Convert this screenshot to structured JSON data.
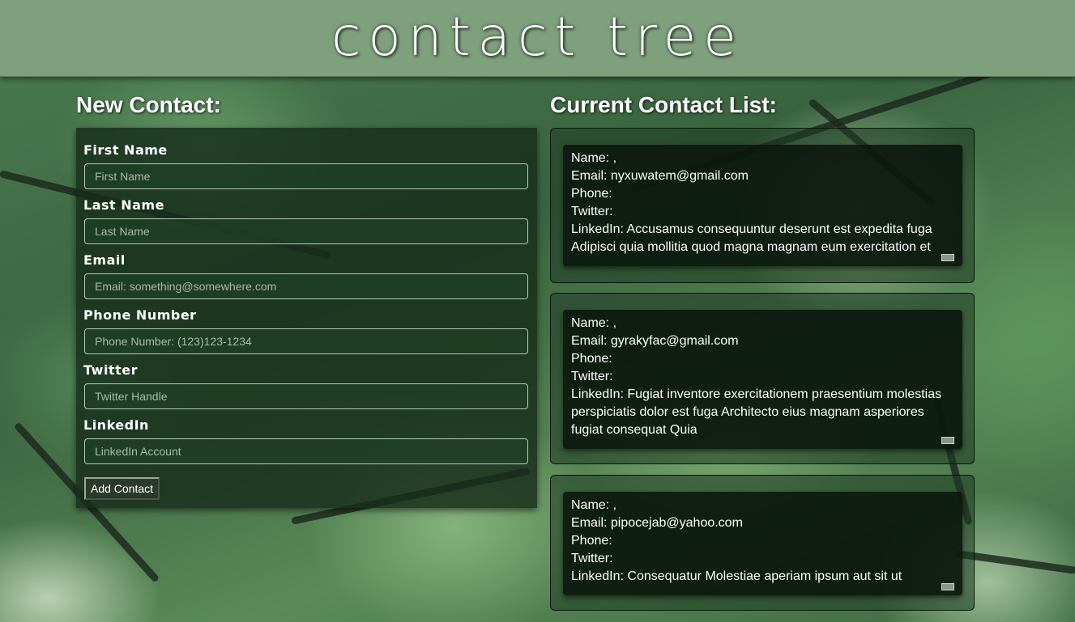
{
  "header": {
    "title": "contact tree"
  },
  "form": {
    "heading": "New Contact:",
    "fields": [
      {
        "label": "First  Name",
        "placeholder": "First Name"
      },
      {
        "label": "Last  Name",
        "placeholder": "Last Name"
      },
      {
        "label": "Email",
        "placeholder": "Email: something@somewhere.com"
      },
      {
        "label": "Phone  Number",
        "placeholder": "Phone Number: (123)123-1234"
      },
      {
        "label": "Twitter",
        "placeholder": "Twitter Handle"
      },
      {
        "label": "LinkedIn",
        "placeholder": "LinkedIn Account"
      }
    ],
    "submit_label": "Add Contact"
  },
  "list": {
    "heading": "Current Contact List:",
    "contacts": [
      {
        "name": "Name: ,",
        "email": "Email: nyxuwatem@gmail.com",
        "phone": "Phone:",
        "twitter": "Twitter:",
        "linkedin": "LinkedIn: Accusamus consequuntur deserunt est expedita fuga Adipisci quia mollitia quod magna magnam eum exercitation et"
      },
      {
        "name": "Name: ,",
        "email": "Email: gyrakyfac@gmail.com",
        "phone": "Phone:",
        "twitter": "Twitter:",
        "linkedin": "LinkedIn: Fugiat inventore exercitationem praesentium molestias perspiciatis dolor est fuga Architecto eius magnam asperiores fugiat consequat Quia"
      },
      {
        "name": "Name: ,",
        "email": "Email: pipocejab@yahoo.com",
        "phone": "Phone:",
        "twitter": "Twitter:",
        "linkedin": "LinkedIn: Consequatur Molestiae aperiam ipsum aut sit ut"
      }
    ]
  }
}
